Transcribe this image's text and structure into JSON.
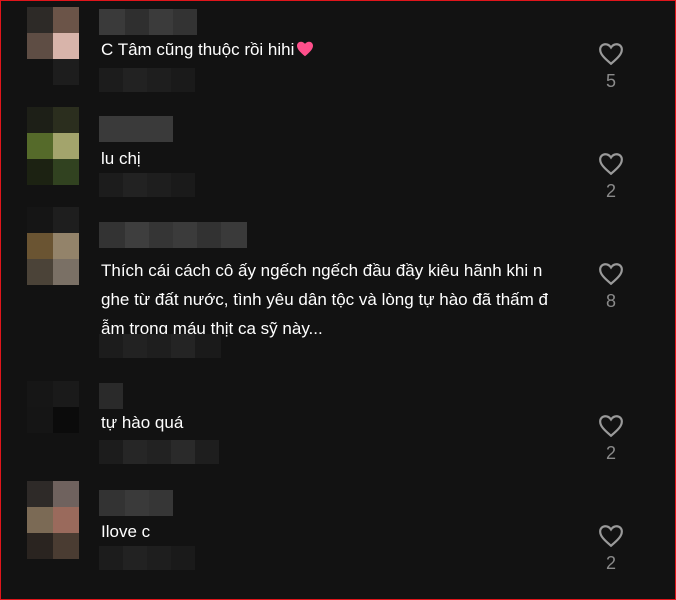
{
  "comments": [
    {
      "text": "C Tâm cũng thuộc rồi hihi",
      "emoji": "pink-heart",
      "likes": "5"
    },
    {
      "text": "lu chị",
      "likes": "2"
    },
    {
      "text": "Thích cái cách cô ấy ngếch ngếch đầu đầy kiêu hãnh khi n\nghe từ đất nước, tình yêu dân tộc và lòng tự hào đã thấm đ\nẫm trong máu thịt ca sỹ này...",
      "likes": "8"
    },
    {
      "text": "tự hào quá",
      "likes": "2"
    },
    {
      "text": "Ilove c",
      "likes": "2"
    }
  ],
  "colors": {
    "background": "#121212",
    "frame_border": "#e0151b",
    "text": "#ffffff",
    "like_count": "#8a8a8a",
    "heart_emoji": "#ff4f8b"
  },
  "icons": {
    "like": "heart-outline-icon",
    "emoji": "pink-heart-icon"
  }
}
